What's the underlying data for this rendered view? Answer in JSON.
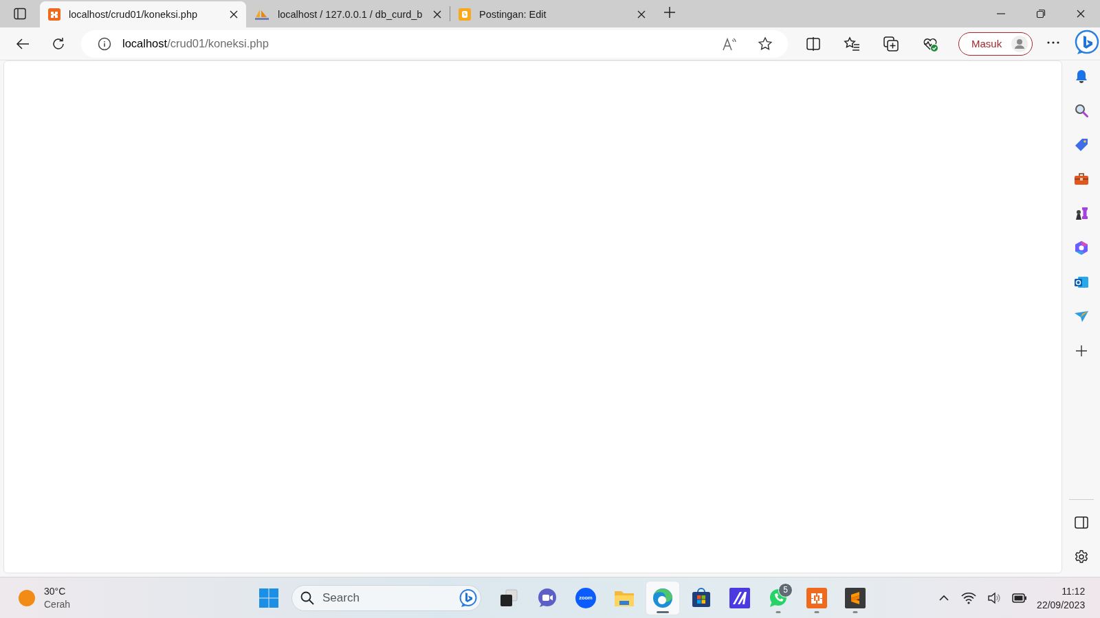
{
  "tabs": [
    {
      "title": "localhost/crud01/koneksi.php",
      "kind": "xampp",
      "selected": true
    },
    {
      "title": "localhost / 127.0.0.1 / db_curd_b",
      "kind": "pma",
      "selected": false
    },
    {
      "title": "Postingan: Edit",
      "kind": "blogger",
      "selected": false
    }
  ],
  "address_bar": {
    "host": "localhost",
    "path": "/crud01/koneksi.php"
  },
  "profile_button": {
    "label": "Masuk"
  },
  "taskbar": {
    "weather": {
      "temperature": "30°C",
      "condition": "Cerah"
    },
    "search": {
      "placeholder": "Search"
    },
    "apps": [
      {
        "kind": "taskview",
        "running": false,
        "selected": false
      },
      {
        "kind": "chat",
        "running": false,
        "selected": false
      },
      {
        "kind": "zoom",
        "label": "zoom",
        "running": false,
        "selected": false
      },
      {
        "kind": "folder",
        "running": false,
        "selected": false
      },
      {
        "kind": "edge",
        "running": true,
        "selected": true
      },
      {
        "kind": "store",
        "running": false,
        "selected": false
      },
      {
        "kind": "designer",
        "running": false,
        "selected": false
      },
      {
        "kind": "whatsapp",
        "badge": "5",
        "running": true,
        "selected": false
      },
      {
        "kind": "xampp",
        "running": true,
        "selected": false
      },
      {
        "kind": "sublime",
        "running": true,
        "selected": false
      }
    ],
    "clock": {
      "time": "11:12",
      "date": "22/09/2023"
    }
  }
}
